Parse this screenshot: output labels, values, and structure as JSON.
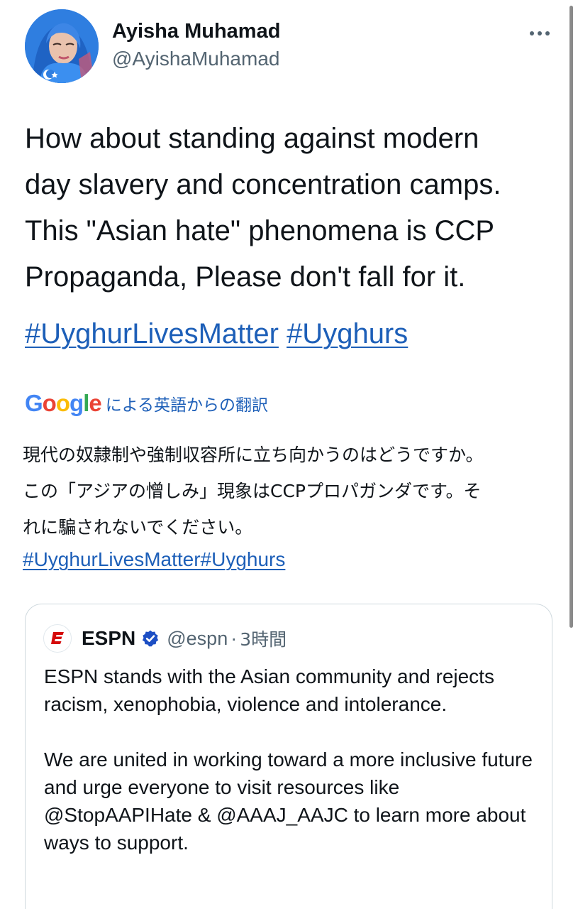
{
  "tweet": {
    "author": {
      "display_name": "Ayisha Muhamad",
      "handle": "@AyishaMuhamad",
      "avatar_icon": "profile-photo"
    },
    "more_icon": "more-options-icon",
    "text": "How about standing against modern\nday slavery and concentration camps.\nThis \"Asian hate\" phenomena is CCP\nPropaganda, Please don't fall for it.",
    "hashtags": [
      "#UyghurLivesMatter",
      "#Uyghurs"
    ]
  },
  "translation": {
    "provider_logo": "Google",
    "label": "による英語からの翻訳",
    "text": "現代の奴隷制や強制収容所に立ち向かうのはどうですか。\nこの「アジアの憎しみ」現象はCCPプロパガンダです。そ\nれに騙されないでください。",
    "hashtags": "#UyghurLivesMatter#Uyghurs"
  },
  "quoted_tweet": {
    "author_name": "ESPN",
    "handle": "@espn",
    "separator": "·",
    "time": "3時間",
    "verified_icon": "verified-badge-icon",
    "paragraphs": [
      "ESPN stands with the Asian community and rejects racism, xenophobia, violence and intolerance.",
      "We are united in working toward a more inclusive future and urge everyone to visit resources like @StopAAPIHate & @AAAJ_AAJC to learn more about ways to support."
    ]
  },
  "colors": {
    "link": "#1d5fb8",
    "secondary_text": "#536471",
    "border": "#cfd9de",
    "espn_red": "#d50a0a",
    "verified_blue": "#1d4fc4"
  }
}
